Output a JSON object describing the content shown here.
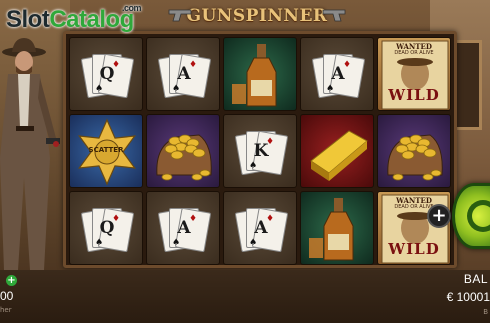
{
  "logo": {
    "slot": "Slot",
    "catalog": "Catalog",
    "com": ".com"
  },
  "game": {
    "title": "GUNSPINNER"
  },
  "reels": {
    "columns": [
      [
        {
          "symbol": "card-fan",
          "letter": "Q",
          "bg": "plain"
        },
        {
          "symbol": "sheriff-star",
          "label": "SCATTER",
          "bg": "blue"
        },
        {
          "symbol": "card-fan",
          "letter": "Q",
          "bg": "plain"
        }
      ],
      [
        {
          "symbol": "card-fan",
          "letter": "A",
          "bg": "plain"
        },
        {
          "symbol": "gold-sack",
          "bg": "purple"
        },
        {
          "symbol": "card-fan",
          "letter": "A",
          "bg": "plain"
        }
      ],
      [
        {
          "symbol": "whiskey-bottle",
          "bg": "green"
        },
        {
          "symbol": "card-fan",
          "letter": "K",
          "bg": "plain"
        },
        {
          "symbol": "card-fan",
          "letter": "A",
          "bg": "plain"
        }
      ],
      [
        {
          "symbol": "card-fan",
          "letter": "A",
          "bg": "plain"
        },
        {
          "symbol": "gold-bar",
          "bg": "red"
        },
        {
          "symbol": "whiskey-bottle",
          "bg": "green"
        }
      ],
      [
        {
          "symbol": "wanted-wild",
          "wanted": "WANTED",
          "sub": "DEAD OR ALIVE",
          "wild": "WILD",
          "bg": "wild"
        },
        {
          "symbol": "gold-sack",
          "bg": "purple"
        },
        {
          "symbol": "wanted-wild",
          "wanted": "WANTED",
          "sub": "DEAD OR ALIVE",
          "wild": "WILD",
          "bg": "wild"
        }
      ]
    ]
  },
  "bottom": {
    "left_value": "00",
    "left_small": "her",
    "balance_label": "BAL",
    "balance_value": "€ 10001",
    "balance_small": "B"
  },
  "colors": {
    "accent_green": "#2fa83a",
    "spin_green": "#90c020",
    "title_gold": "#e8c27a"
  },
  "icons": {
    "spin": "spin-refresh-icon",
    "bet_plus": "plus-icon",
    "pistol": "pistol-icon"
  }
}
